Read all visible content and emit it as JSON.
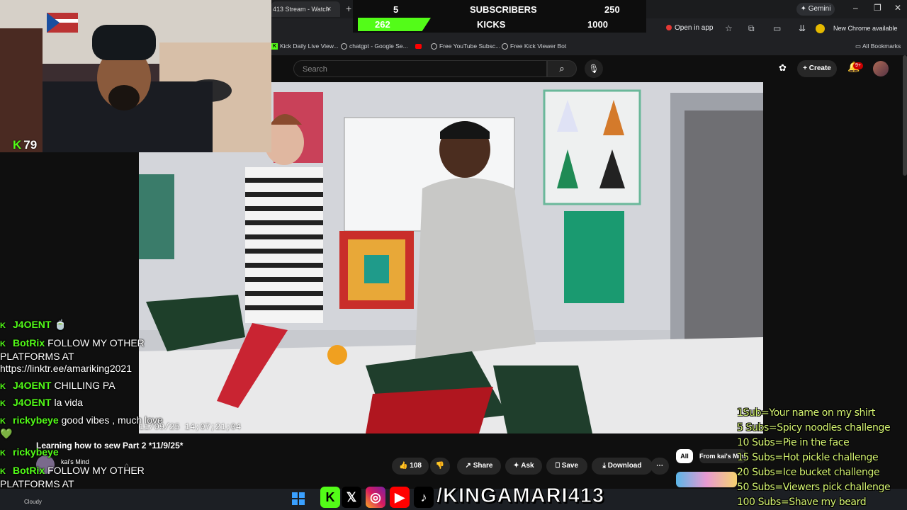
{
  "browser": {
    "active_tab_title": "413 Stream - Watch",
    "tab_close": "×",
    "new_tab": "+",
    "gemini_label": "Gemini",
    "open_in_app": "Open in app",
    "new_chrome": "New Chrome available",
    "all_bookmarks": "All Bookmarks",
    "bookmarks": [
      {
        "label": "Kick Daily Live View...",
        "icon": "kick-icon"
      },
      {
        "label": "chatgpt - Google Se...",
        "icon": "google-icon"
      },
      {
        "label": "",
        "icon": "youtube-icon"
      },
      {
        "label": "Free YouTube Subsc...",
        "icon": "globe-icon"
      },
      {
        "label": "Free Kick Viewer Bot",
        "icon": "globe-icon"
      }
    ]
  },
  "goals_overlay": {
    "subs_current": "5",
    "subs_label": "SUBSCRIBERS",
    "subs_target": "250",
    "kicks_current": "262",
    "kicks_label": "KICKS",
    "kicks_target": "1000",
    "kicks_progress": 0.262,
    "accent": "#53fc18"
  },
  "youtube": {
    "search_placeholder": "Search",
    "create_label": "Create",
    "notifications_badge": "9+",
    "video_title": "Learning how to sew Part 2 *11/9/25*",
    "channel_name": "kai's Mind",
    "timestamp": "11/09/25 14;07;21;04",
    "like_count": "108",
    "share_label": "Share",
    "ask_label": "Ask",
    "save_label": "Save",
    "download_label": "Download",
    "chip_all": "All",
    "chip_from": "From kai's Mind"
  },
  "webcam": {
    "kick_viewers": "79"
  },
  "chat": [
    {
      "user": "J4OENT",
      "msg": "",
      "emote": "🍵"
    },
    {
      "user": "BotRix",
      "msg": "FOLLOW MY OTHER PLATFORMS AT https://linktr.ee/amariking2021"
    },
    {
      "user": "J4OENT",
      "msg": "CHILLING PA"
    },
    {
      "user": "J4OENT",
      "msg": "la vida"
    },
    {
      "user": "rickybeye",
      "msg": "good vibes , much love",
      "emote": "💚"
    },
    {
      "user": "rickybeye",
      "msg": ""
    },
    {
      "user": "BotRix",
      "msg": "FOLLOW MY OTHER PLATFORMS AT https://linktr.ee/amariking2021"
    }
  ],
  "taskbar": {
    "weather": "Cloudy",
    "handle": "/KINGAMARI413"
  },
  "sub_goals": [
    "1Sub=Your name on my shirt",
    "5 Subs=Spicy noodles challenge",
    "10 Subs=Pie in the face",
    "15 Subs=Hot pickle challenge",
    "20 Subs=Ice bucket challenge",
    "50 Subs=Viewers pick challenge",
    "100 Subs=Shave my beard"
  ]
}
